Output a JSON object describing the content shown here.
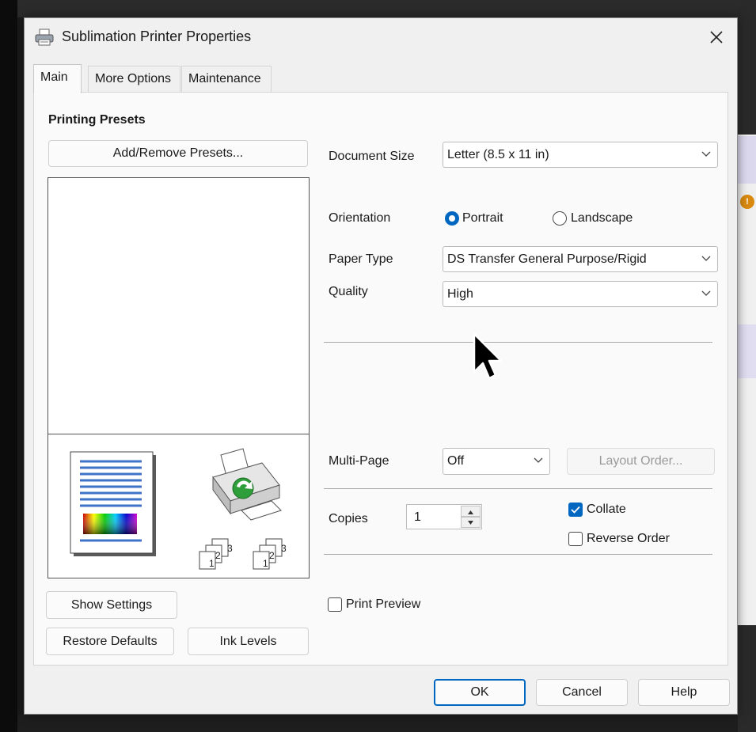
{
  "window": {
    "title": "Sublimation Printer Properties",
    "close_symbol": "✕"
  },
  "tabs": [
    {
      "label": "Main",
      "active": true
    },
    {
      "label": "More Options",
      "active": false
    },
    {
      "label": "Maintenance",
      "active": false
    }
  ],
  "presets": {
    "heading": "Printing Presets",
    "add_remove_label": "Add/Remove Presets..."
  },
  "form": {
    "document_size": {
      "label": "Document Size",
      "value": "Letter (8.5 x 11 in)"
    },
    "orientation": {
      "label": "Orientation",
      "portrait": "Portrait",
      "landscape": "Landscape",
      "selected": "Portrait"
    },
    "paper_type": {
      "label": "Paper Type",
      "value": "DS Transfer General Purpose/Rigid"
    },
    "quality": {
      "label": "Quality",
      "value": "High"
    },
    "multi_page": {
      "label": "Multi-Page",
      "value": "Off",
      "layout_order_label": "Layout Order..."
    },
    "copies": {
      "label": "Copies",
      "value": "1"
    },
    "collate": {
      "label": "Collate",
      "checked": true
    },
    "reverse_order": {
      "label": "Reverse Order",
      "checked": false
    },
    "print_preview": {
      "label": "Print Preview",
      "checked": false
    }
  },
  "preview": {
    "collate_numbers": [
      "1",
      "2",
      "3"
    ]
  },
  "left_buttons": {
    "show_settings": "Show Settings",
    "restore_defaults": "Restore Defaults",
    "ink_levels": "Ink Levels"
  },
  "footer": {
    "ok": "OK",
    "cancel": "Cancel",
    "help": "Help"
  },
  "colors": {
    "accent": "#0067c0",
    "dialog_bg": "#f0f0f0",
    "panel_bg": "#fafafa"
  },
  "icons": {
    "title": "printer-icon",
    "close": "close-icon",
    "dropdown": "chevron-down-icon",
    "cursor": "mouse-pointer-icon"
  }
}
